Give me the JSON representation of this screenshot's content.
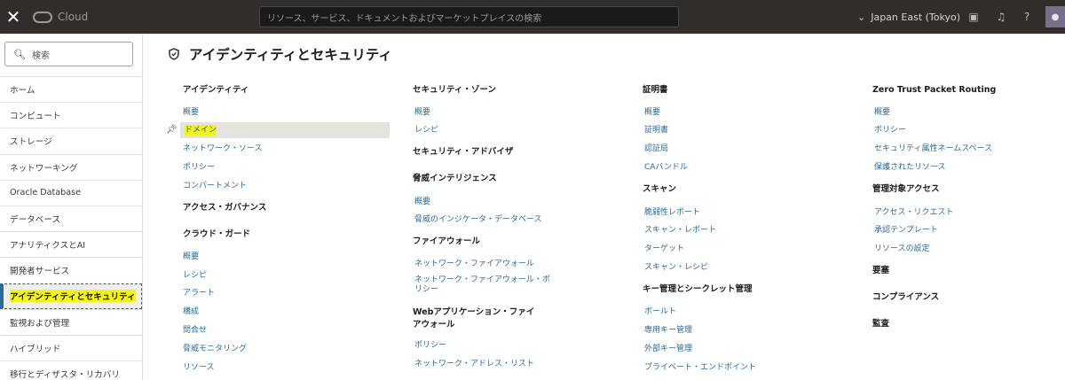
{
  "topbar": {
    "close_icon": "close-icon",
    "logo_text": "Cloud",
    "search_placeholder": "リソース、サービス、ドキュメントおよびマーケットプレイスの検索",
    "region_label": "Japan East (Tokyo)",
    "region_icon": "chevron-down-icon"
  },
  "sidebar": {
    "search_placeholder": "検索",
    "items": [
      {
        "label": "ホーム"
      },
      {
        "label": "コンピュート"
      },
      {
        "label": "ストレージ"
      },
      {
        "label": "ネットワーキング"
      },
      {
        "label": "Oracle Database"
      },
      {
        "label": "データベース"
      },
      {
        "label": "アナリティクスとAI"
      },
      {
        "label": "開発者サービス"
      },
      {
        "label": "アイデンティティとセキュリティ"
      },
      {
        "label": "監視および管理"
      },
      {
        "label": "ハイブリッド"
      },
      {
        "label": "移行とディザスタ・リカバリ"
      }
    ],
    "active_index": 8
  },
  "main": {
    "title": "アイデンティティとセキュリティ",
    "col1": {
      "h1": "アイデンティティ",
      "l1": "概要",
      "l2": "ドメイン",
      "l3": "ネットワーク・ソース",
      "l4": "ポリシー",
      "l5": "コンパートメント",
      "h2": "アクセス・ガバナンス",
      "h3": "クラウド・ガード",
      "l6": "概要",
      "l7": "レシピ",
      "l8": "アラート",
      "l9": "構成",
      "l10": "問合せ",
      "l11": "脅威モニタリング",
      "l12": "リソース"
    },
    "col2": {
      "h1": "セキュリティ・ゾーン",
      "l1": "概要",
      "l2": "レシピ",
      "h2": "セキュリティ・アドバイザ",
      "h3": "脅威インテリジェンス",
      "l3": "概要",
      "l4": "脅威のインジケータ・データベース",
      "h4": "ファイアウォール",
      "l5": "ネットワーク・ファイアウォール",
      "l6": "ネットワーク・ファイアウォール・ポリシー",
      "h5": "Webアプリケーション・ファイアウォール",
      "l7": "ポリシー",
      "l8": "ネットワーク・アドレス・リスト"
    },
    "col3": {
      "h1": "証明書",
      "l1": "概要",
      "l2": "証明書",
      "l3": "認証局",
      "l4": "CAバンドル",
      "h2": "スキャン",
      "l5": "脆弱性レポート",
      "l6": "スキャン・レポート",
      "l7": "ターゲット",
      "l8": "スキャン・レシピ",
      "h3": "キー管理とシークレット管理",
      "l9": "ボールト",
      "l10": "専用キー管理",
      "l11": "外部キー管理",
      "l12": "プライベート・エンドポイント"
    },
    "col4": {
      "h1": "Zero Trust Packet Routing",
      "l1": "概要",
      "l2": "ポリシー",
      "l3": "セキュリティ属性ネームスペース",
      "l4": "保護されたリソース",
      "h2": "管理対象アクセス",
      "l5": "アクセス・リクエスト",
      "l6": "承認テンプレート",
      "l7": "リソースの設定",
      "h3": "要塞",
      "h4": "コンプライアンス",
      "h5": "監査"
    }
  }
}
